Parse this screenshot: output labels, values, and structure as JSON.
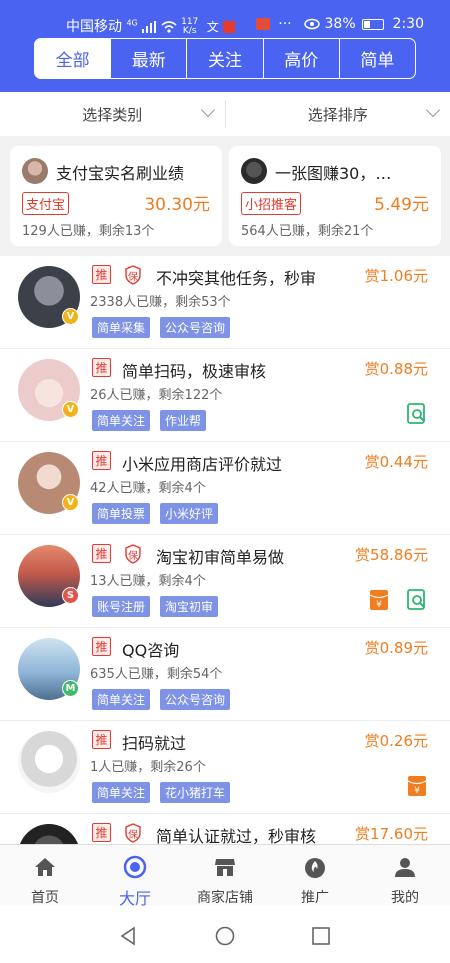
{
  "statusbar": {
    "carrier": "中国移动",
    "net": "4G",
    "speed_top": "117",
    "speed_bottom": "K/s",
    "battery": "38%",
    "time": "2:30",
    "more": "···"
  },
  "tabs": [
    "全部",
    "最新",
    "关注",
    "高价",
    "简单"
  ],
  "filters": {
    "category": "选择类别",
    "sort": "选择排序"
  },
  "featured": [
    {
      "title": "支付宝实名刷业绩",
      "tag": "支付宝",
      "price": "30.30元",
      "meta": "129人已赚，剩余13个"
    },
    {
      "title": "一张图赚30，…",
      "tag": "小招推客",
      "price": "5.49元",
      "meta": "564人已赚，剩余21个"
    }
  ],
  "tasks": [
    {
      "tui": "推",
      "bao": "保",
      "title": "不冲突其他任务，秒审",
      "reward": "赏1.06元",
      "meta": "2338人已赚，剩余53个",
      "tags": [
        "简单采集",
        "公众号咨询"
      ],
      "badge": "V",
      "badge_color": "#f2b21a",
      "avatar_color": "#555b66",
      "icons": []
    },
    {
      "tui": "推",
      "title": "简单扫码，极速审核",
      "reward": "赏0.88元",
      "meta": "26人已赚，剩余122个",
      "tags": [
        "简单关注",
        "作业帮"
      ],
      "badge": "V",
      "badge_color": "#f2b21a",
      "avatar_color": "#f1d6d6",
      "icons": [
        "search-doc"
      ]
    },
    {
      "tui": "推",
      "title": "小米应用商店评价就过",
      "reward": "赏0.44元",
      "meta": "42人已赚，剩余4个",
      "tags": [
        "简单投票",
        "小米好评"
      ],
      "badge": "V",
      "badge_color": "#f2b21a",
      "avatar_color": "#c9a48c",
      "icons": []
    },
    {
      "tui": "推",
      "bao": "保",
      "title": "淘宝初审简单易做",
      "reward": "赏58.86元",
      "meta": "13人已赚，剩余4个",
      "tags": [
        "账号注册",
        "淘宝初审"
      ],
      "badge": "S",
      "badge_color": "#e2534a",
      "avatar_color": "#c45a4d",
      "icons": [
        "yen-envelope",
        "search-doc"
      ]
    },
    {
      "tui": "推",
      "title": "QQ咨询",
      "reward": "赏0.89元",
      "meta": "635人已赚，剩余54个",
      "tags": [
        "简单关注",
        "公众号咨询"
      ],
      "badge": "M",
      "badge_color": "#3fb96b",
      "avatar_color": "#8fb6d8",
      "icons": []
    },
    {
      "tui": "推",
      "title": "扫码就过",
      "reward": "赏0.26元",
      "meta": "1人已赚，剩余26个",
      "tags": [
        "简单关注",
        "花小猪打车"
      ],
      "badge": "",
      "badge_color": "",
      "avatar_color": "#eeeeee",
      "icons": [
        "yen-envelope"
      ]
    },
    {
      "tui": "推",
      "bao": "保",
      "title": "简单认证就过，秒审核",
      "reward": "赏17.60元",
      "meta": "",
      "tags": [],
      "badge": "",
      "badge_color": "",
      "avatar_color": "#333333",
      "icons": []
    }
  ],
  "nav": [
    "首页",
    "大厅",
    "商家店铺",
    "推广",
    "我的"
  ],
  "colors": {
    "brand": "#4a63f0",
    "price": "#f07d20",
    "red": "#e53a2e",
    "chip": "#7e93e6"
  }
}
